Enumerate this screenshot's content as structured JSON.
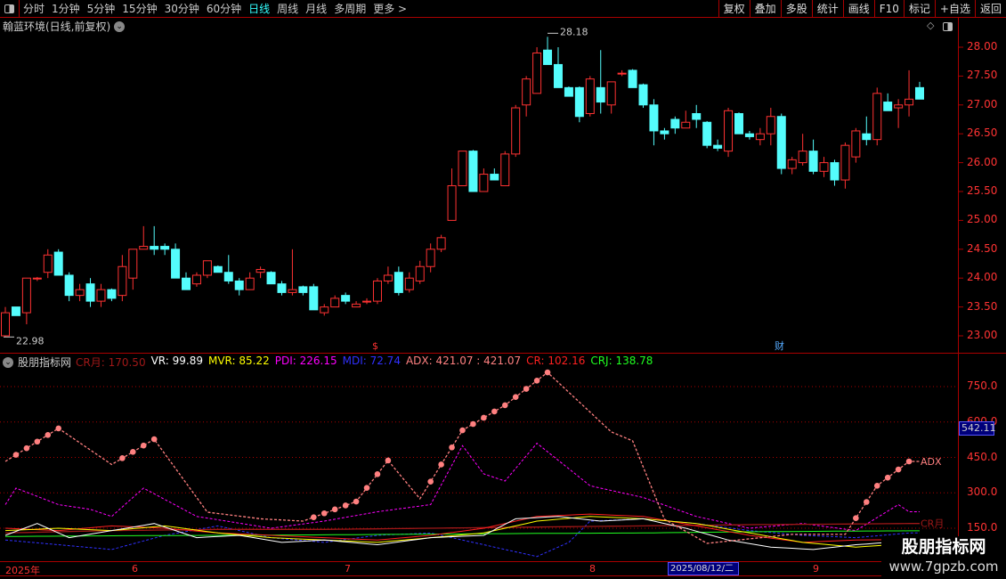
{
  "toolbar": {
    "timeframes": [
      "分时",
      "1分钟",
      "5分钟",
      "15分钟",
      "30分钟",
      "60分钟",
      "日线",
      "周线",
      "月线",
      "多周期",
      "更多 >"
    ],
    "active": "日线",
    "right_buttons": [
      "复权",
      "叠加",
      "多股",
      "统计",
      "画线",
      "F10",
      "标记",
      "+自选",
      "返回"
    ]
  },
  "stock_title": "翰蓝环境(日线,前复权)",
  "price_axis": {
    "labels": [
      "28.00",
      "27.50",
      "27.00",
      "26.50",
      "26.00",
      "25.50",
      "25.00",
      "24.50",
      "24.00",
      "23.50",
      "23.00"
    ],
    "values": [
      28,
      27.5,
      27,
      26.5,
      26,
      25.5,
      25,
      24.5,
      24,
      23.5,
      23
    ]
  },
  "annotations": {
    "high": "28.18",
    "low": "22.98",
    "marker_s": "$",
    "marker_cai": "财"
  },
  "candles": [
    [
      23.0,
      23.5,
      22.98,
      23.4
    ],
    [
      23.5,
      23.5,
      23.35,
      23.35
    ],
    [
      23.4,
      24.0,
      23.2,
      24.0
    ],
    [
      24.0,
      24.02,
      23.95,
      24.0
    ],
    [
      24.1,
      24.5,
      24.0,
      24.4
    ],
    [
      24.45,
      24.5,
      24.05,
      24.05
    ],
    [
      24.05,
      24.1,
      23.6,
      23.7
    ],
    [
      23.7,
      23.9,
      23.6,
      23.8
    ],
    [
      23.9,
      24.0,
      23.5,
      23.6
    ],
    [
      23.6,
      23.9,
      23.5,
      23.8
    ],
    [
      23.8,
      23.82,
      23.6,
      23.65
    ],
    [
      23.7,
      24.4,
      23.6,
      24.2
    ],
    [
      24.0,
      24.5,
      23.8,
      24.5
    ],
    [
      24.5,
      24.9,
      24.5,
      24.55
    ],
    [
      24.55,
      24.9,
      24.4,
      24.5
    ],
    [
      24.55,
      24.6,
      24.4,
      24.5
    ],
    [
      24.5,
      24.6,
      24.0,
      24.0
    ],
    [
      24.0,
      24.1,
      23.8,
      23.8
    ],
    [
      23.9,
      24.1,
      23.85,
      24.05
    ],
    [
      24.05,
      24.3,
      24.0,
      24.3
    ],
    [
      24.2,
      24.22,
      24.1,
      24.1
    ],
    [
      24.1,
      24.4,
      23.9,
      23.95
    ],
    [
      23.95,
      24.0,
      23.7,
      23.8
    ],
    [
      23.8,
      24.1,
      23.8,
      24.0
    ],
    [
      24.1,
      24.2,
      24.0,
      24.15
    ],
    [
      24.1,
      24.12,
      23.9,
      23.9
    ],
    [
      23.9,
      23.95,
      23.7,
      23.75
    ],
    [
      23.75,
      24.5,
      23.7,
      23.8
    ],
    [
      23.85,
      23.87,
      23.7,
      23.75
    ],
    [
      23.85,
      23.9,
      23.45,
      23.45
    ],
    [
      23.4,
      23.55,
      23.35,
      23.5
    ],
    [
      23.5,
      23.7,
      23.5,
      23.65
    ],
    [
      23.7,
      23.75,
      23.55,
      23.6
    ],
    [
      23.5,
      23.6,
      23.5,
      23.55
    ],
    [
      23.6,
      23.65,
      23.55,
      23.6
    ],
    [
      23.6,
      24.0,
      23.55,
      23.95
    ],
    [
      23.95,
      24.2,
      23.9,
      24.05
    ],
    [
      24.1,
      24.2,
      23.7,
      23.75
    ],
    [
      23.8,
      24.1,
      23.75,
      24.0
    ],
    [
      23.95,
      24.3,
      23.9,
      24.2
    ],
    [
      24.2,
      24.6,
      24.1,
      24.5
    ],
    [
      24.5,
      24.75,
      24.45,
      24.7
    ],
    [
      25.0,
      25.9,
      25.0,
      25.6
    ],
    [
      25.6,
      26.2,
      25.6,
      26.2
    ],
    [
      26.2,
      26.22,
      25.5,
      25.5
    ],
    [
      25.5,
      25.9,
      25.5,
      25.8
    ],
    [
      25.8,
      25.9,
      25.7,
      25.7
    ],
    [
      25.6,
      26.2,
      25.6,
      26.15
    ],
    [
      26.15,
      27.0,
      26.1,
      26.95
    ],
    [
      27.0,
      27.5,
      26.8,
      27.45
    ],
    [
      27.2,
      28.0,
      27.2,
      27.9
    ],
    [
      27.95,
      28.18,
      27.7,
      27.7
    ],
    [
      27.7,
      28.0,
      27.3,
      27.3
    ],
    [
      27.3,
      27.32,
      27.15,
      27.15
    ],
    [
      27.3,
      27.32,
      26.7,
      26.8
    ],
    [
      26.85,
      27.5,
      26.8,
      27.45
    ],
    [
      27.3,
      27.95,
      26.85,
      27.05
    ],
    [
      27.0,
      27.4,
      26.85,
      27.4
    ],
    [
      27.55,
      27.6,
      27.5,
      27.55
    ],
    [
      27.6,
      27.62,
      27.3,
      27.3
    ],
    [
      27.35,
      27.37,
      26.95,
      27.0
    ],
    [
      27.0,
      27.1,
      26.3,
      26.55
    ],
    [
      26.55,
      26.6,
      26.4,
      26.5
    ],
    [
      26.75,
      26.8,
      26.5,
      26.6
    ],
    [
      26.6,
      26.9,
      26.6,
      26.7
    ],
    [
      26.85,
      27.0,
      26.6,
      26.75
    ],
    [
      26.7,
      26.72,
      26.25,
      26.3
    ],
    [
      26.3,
      26.4,
      26.2,
      26.25
    ],
    [
      26.2,
      26.95,
      26.1,
      26.9
    ],
    [
      26.85,
      26.87,
      26.5,
      26.5
    ],
    [
      26.5,
      26.55,
      26.4,
      26.45
    ],
    [
      26.4,
      26.6,
      26.3,
      26.5
    ],
    [
      26.5,
      26.95,
      26.3,
      26.8
    ],
    [
      26.8,
      26.85,
      25.8,
      25.9
    ],
    [
      25.9,
      26.1,
      25.8,
      26.05
    ],
    [
      26.0,
      26.5,
      25.95,
      26.2
    ],
    [
      26.2,
      26.4,
      25.8,
      25.85
    ],
    [
      25.85,
      26.1,
      25.75,
      26.0
    ],
    [
      26.0,
      26.05,
      25.6,
      25.7
    ],
    [
      25.7,
      26.35,
      25.55,
      26.3
    ],
    [
      26.1,
      26.6,
      26.0,
      26.55
    ],
    [
      26.5,
      26.8,
      26.3,
      26.4
    ],
    [
      26.4,
      27.3,
      26.3,
      27.2
    ],
    [
      27.05,
      27.2,
      26.9,
      26.9
    ],
    [
      26.95,
      27.1,
      26.6,
      27.0
    ],
    [
      27.0,
      27.6,
      26.8,
      27.1
    ],
    [
      27.3,
      27.4,
      27.1,
      27.1
    ]
  ],
  "indicator": {
    "name": "股朋指标网",
    "items": [
      {
        "label": "CR月: 170.50",
        "color": "#a01818"
      },
      {
        "label": "VR: 99.89",
        "color": "#ffffff"
      },
      {
        "label": "MVR: 85.22",
        "color": "#ffff00"
      },
      {
        "label": "PDI: 226.15",
        "color": "#ff00ff"
      },
      {
        "label": "MDI: 72.74",
        "color": "#3030ff"
      },
      {
        "label": "ADX: 421.07  : 421.07",
        "color": "#ff8080"
      },
      {
        "label": "CR: 102.16",
        "color": "#ff2020"
      },
      {
        "label": "CRJ: 138.78",
        "color": "#20ff20"
      }
    ],
    "axis_labels": [
      "750.0",
      "600.0",
      "450.0",
      "300.0",
      "150.0"
    ],
    "axis_values": [
      750,
      600,
      450,
      300,
      150
    ],
    "current_value": "542.11",
    "line_tags": {
      "adx": "ADX",
      "crm": "CR月"
    }
  },
  "series": {
    "ADX": {
      "color": "#ff8080",
      "pts": [
        [
          0,
          433
        ],
        [
          5,
          573
        ],
        [
          10,
          420
        ],
        [
          14,
          527
        ],
        [
          19,
          218
        ],
        [
          24,
          190
        ],
        [
          28,
          180
        ],
        [
          33,
          263
        ],
        [
          36,
          437
        ],
        [
          39,
          275
        ],
        [
          43,
          565
        ],
        [
          47,
          671
        ],
        [
          51,
          810
        ],
        [
          57,
          558
        ],
        [
          59,
          520
        ],
        [
          62,
          188
        ],
        [
          66,
          86
        ],
        [
          74,
          124
        ],
        [
          79,
          124
        ],
        [
          82,
          330
        ],
        [
          85,
          433
        ]
      ]
    },
    "PDI": {
      "color": "#ff00ff",
      "pts": [
        [
          0,
          250
        ],
        [
          1,
          320
        ],
        [
          5,
          250
        ],
        [
          8,
          230
        ],
        [
          10,
          200
        ],
        [
          13,
          320
        ],
        [
          18,
          200
        ],
        [
          25,
          150
        ],
        [
          30,
          180
        ],
        [
          35,
          220
        ],
        [
          40,
          250
        ],
        [
          43,
          500
        ],
        [
          45,
          380
        ],
        [
          47,
          350
        ],
        [
          50,
          510
        ],
        [
          55,
          330
        ],
        [
          60,
          280
        ],
        [
          65,
          200
        ],
        [
          70,
          150
        ],
        [
          75,
          170
        ],
        [
          80,
          140
        ],
        [
          84,
          250
        ],
        [
          85,
          220
        ]
      ]
    },
    "MDI": {
      "color": "#3030ff",
      "pts": [
        [
          0,
          100
        ],
        [
          5,
          80
        ],
        [
          10,
          60
        ],
        [
          15,
          120
        ],
        [
          20,
          160
        ],
        [
          25,
          110
        ],
        [
          30,
          90
        ],
        [
          35,
          120
        ],
        [
          40,
          130
        ],
        [
          45,
          80
        ],
        [
          50,
          30
        ],
        [
          53,
          90
        ],
        [
          55,
          180
        ],
        [
          60,
          190
        ],
        [
          65,
          170
        ],
        [
          70,
          140
        ],
        [
          75,
          120
        ],
        [
          80,
          110
        ],
        [
          85,
          130
        ]
      ]
    },
    "CRM": {
      "color": "#a01818",
      "pts": [
        [
          0,
          130
        ],
        [
          10,
          140
        ],
        [
          20,
          145
        ],
        [
          30,
          145
        ],
        [
          40,
          150
        ],
        [
          50,
          155
        ],
        [
          60,
          160
        ],
        [
          70,
          165
        ],
        [
          80,
          168
        ],
        [
          85,
          170
        ]
      ]
    },
    "VR": {
      "color": "#ffffff",
      "pts": [
        [
          0,
          120
        ],
        [
          3,
          170
        ],
        [
          6,
          110
        ],
        [
          10,
          140
        ],
        [
          14,
          170
        ],
        [
          18,
          110
        ],
        [
          22,
          120
        ],
        [
          26,
          90
        ],
        [
          30,
          100
        ],
        [
          35,
          80
        ],
        [
          40,
          110
        ],
        [
          45,
          120
        ],
        [
          48,
          190
        ],
        [
          52,
          200
        ],
        [
          56,
          180
        ],
        [
          60,
          190
        ],
        [
          64,
          150
        ],
        [
          68,
          100
        ],
        [
          72,
          70
        ],
        [
          76,
          60
        ],
        [
          80,
          80
        ],
        [
          83,
          90
        ],
        [
          85,
          100
        ]
      ]
    },
    "MVR": {
      "color": "#ffff00",
      "pts": [
        [
          0,
          140
        ],
        [
          5,
          150
        ],
        [
          10,
          140
        ],
        [
          15,
          160
        ],
        [
          20,
          130
        ],
        [
          25,
          110
        ],
        [
          30,
          100
        ],
        [
          35,
          90
        ],
        [
          40,
          110
        ],
        [
          45,
          130
        ],
        [
          50,
          180
        ],
        [
          55,
          200
        ],
        [
          60,
          190
        ],
        [
          65,
          170
        ],
        [
          70,
          130
        ],
        [
          75,
          90
        ],
        [
          80,
          70
        ],
        [
          85,
          85
        ]
      ]
    },
    "CR": {
      "color": "#ff2020",
      "pts": [
        [
          0,
          150
        ],
        [
          5,
          140
        ],
        [
          10,
          160
        ],
        [
          15,
          150
        ],
        [
          20,
          130
        ],
        [
          25,
          120
        ],
        [
          30,
          110
        ],
        [
          35,
          100
        ],
        [
          40,
          120
        ],
        [
          45,
          150
        ],
        [
          50,
          200
        ],
        [
          55,
          210
        ],
        [
          60,
          200
        ],
        [
          65,
          160
        ],
        [
          70,
          120
        ],
        [
          75,
          90
        ],
        [
          80,
          100
        ],
        [
          85,
          102
        ]
      ]
    },
    "CRJ": {
      "color": "#20ff20",
      "pts": [
        [
          0,
          115
        ],
        [
          10,
          118
        ],
        [
          20,
          120
        ],
        [
          30,
          122
        ],
        [
          40,
          125
        ],
        [
          50,
          128
        ],
        [
          60,
          130
        ],
        [
          70,
          135
        ],
        [
          80,
          138
        ],
        [
          85,
          139
        ]
      ]
    }
  },
  "x_axis": {
    "labels": [
      "2025年",
      "6",
      "7",
      "8",
      "9"
    ],
    "selected_date": "2025/08/12/二"
  },
  "watermark": {
    "title": "股朋指标网",
    "url": "www.7gpzb.com"
  }
}
